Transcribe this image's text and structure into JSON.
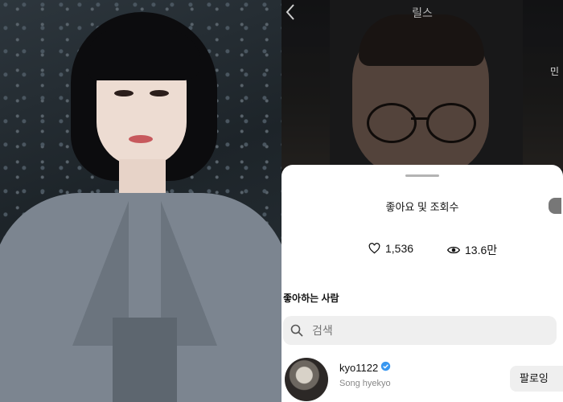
{
  "header": {
    "title": "릴스",
    "side_text": "민"
  },
  "sheet": {
    "title": "좋아요 및 조회수",
    "likes_count": "1,536",
    "views_count": "13.6만",
    "section_label": "좋아하는 사람",
    "search": {
      "placeholder": "검색"
    },
    "users": [
      {
        "username": "kyo1122",
        "full_name": "Song hyekyo",
        "verified": true,
        "follow_label": "팔로잉"
      }
    ]
  },
  "icons": {
    "back": "chevron-left-icon",
    "likes": "heart-icon",
    "views": "eye-icon",
    "search": "search-icon",
    "verified": "verified-badge-icon"
  },
  "colors": {
    "verified": "#3897f0",
    "sheet_bg": "#ffffff",
    "search_bg": "#efefef"
  }
}
